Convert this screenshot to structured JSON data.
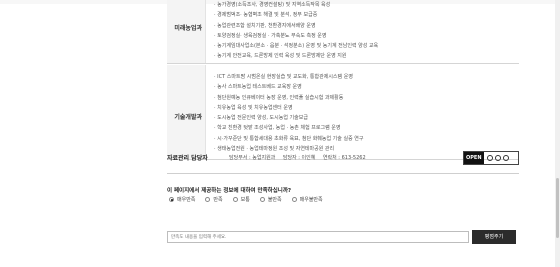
{
  "sections": [
    {
      "category": "미래농업과",
      "items": [
        "· 농가경영(소득조사, 경영컨설팅) 및 지역소득작목 육성",
        "· 경제범벅조· 농협벽조 해결 및 분석, 정부 보급중",
        "· 농업관련조합 설치기판, 천환경지에서배양 운영",
        "· 토양검정실· 생육검정실 · 가축분뇨 부숙도 측정 운영",
        "· 농기계임대사업소(본소 · 읍분 · 석정분소) 운영 및 농기계 전남인력 양성 교육",
        "· 농기계 안전교육, 드론방제 인력 육성 및 드론방제단 운영 지원"
      ]
    },
    {
      "category": "기술개발과",
      "items": [
        "· ICT 스마트팜 시범온실 현장실습 및 교도화, 통합관제시스템 운영",
        "· 농사 스마트농업 테스트베드 교육장 운영",
        "· 첨단원예농 인큐베이터 농장 운영, 인력풀 실습시험 과제활동",
        "· 치유농업 육성 및 치유농업센터 운영",
        "· 도시농업 전문인력 양성, 도시농업 기술보급",
        "· 학교 친환경 텃밭 조성사업, 농업 · 농촌 체험 프로그램 운영",
        "· 시·가꾸준단 및 통합세대용 초화류 육묘, 첨단 화훼농업 기술 실증 연구",
        "· 생태농업전원 · 농업테마정원 조성 및 자연테마공원 관리"
      ]
    }
  ],
  "manager": {
    "title": "자료관리 담당자",
    "department": "담당부서 : 농업지원과",
    "person": "담당자 : 이인혜",
    "contact": "연락처 : 613-5262",
    "kogl_label": "OPEN"
  },
  "survey": {
    "question": "이 페이지에서 제공하는 정보에 대하여 만족하십니까?",
    "options": [
      "매우만족",
      "만족",
      "보통",
      "불만족",
      "매우불만족"
    ],
    "selected": "매우만족",
    "feedback_placeholder": "만족도 내용을 입력해 주세요.",
    "submit_label": "평점주기"
  }
}
